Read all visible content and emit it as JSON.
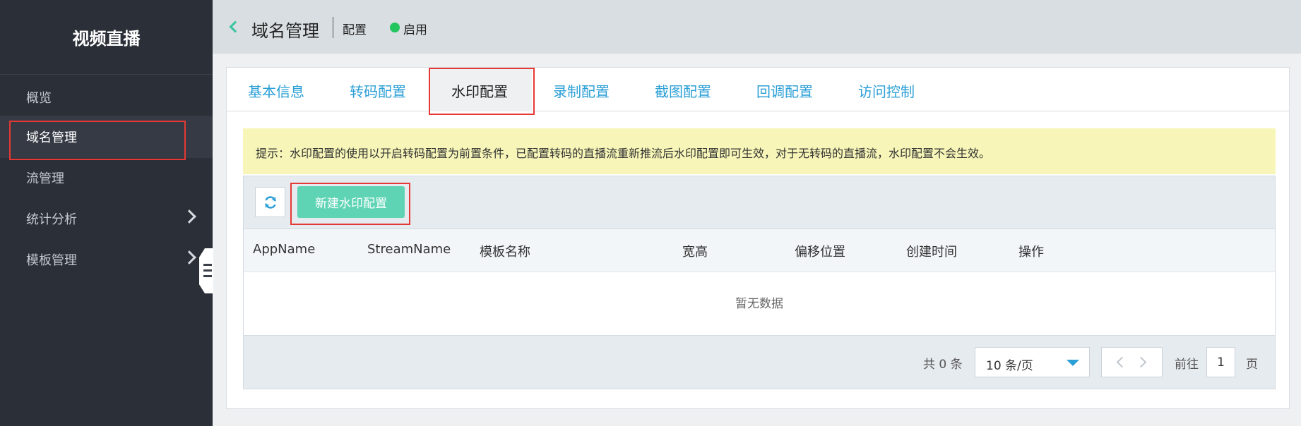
{
  "sidebar": {
    "title": "视频直播",
    "items": [
      {
        "label": "概览"
      },
      {
        "label": "域名管理"
      },
      {
        "label": "流管理"
      },
      {
        "label": "统计分析"
      },
      {
        "label": "模板管理"
      }
    ]
  },
  "header": {
    "title": "域名管理",
    "sub": "配置",
    "status": "启用"
  },
  "tabs": [
    {
      "label": "基本信息"
    },
    {
      "label": "转码配置"
    },
    {
      "label": "水印配置"
    },
    {
      "label": "录制配置"
    },
    {
      "label": "截图配置"
    },
    {
      "label": "回调配置"
    },
    {
      "label": "访问控制"
    }
  ],
  "notice": "提示：水印配置的使用以开启转码配置为前置条件，已配置转码的直播流重新推流后水印配置即可生效，对于无转码的直播流，水印配置不会生效。",
  "toolbar": {
    "new_button": "新建水印配置"
  },
  "table": {
    "columns": [
      "AppName",
      "StreamName",
      "模板名称",
      "宽高",
      "偏移位置",
      "创建时间",
      "操作"
    ],
    "empty_text": "暂无数据"
  },
  "pager": {
    "total": "共 0 条",
    "page_size": "10 条/页",
    "goto_label": "前往",
    "current_page": "1",
    "page_label": "页"
  },
  "colors": {
    "sidebar_bg": "#2b2f38",
    "accent_green": "#5fd4b5",
    "link_blue": "#2a9fd6",
    "highlight_red": "#e53935",
    "notice_bg": "#f7f6b8"
  }
}
